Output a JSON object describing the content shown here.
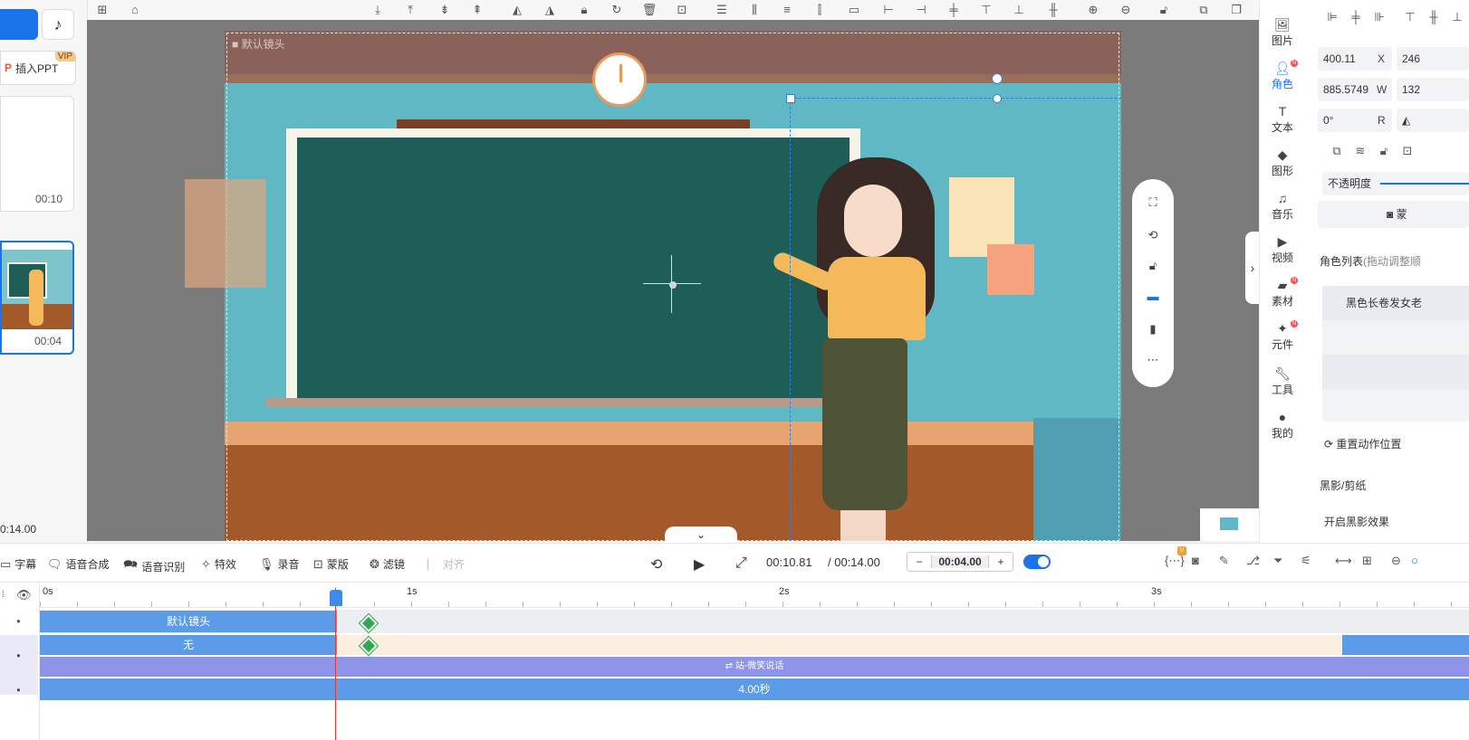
{
  "left_panel": {
    "insert_ppt_label": "插入PPT",
    "vip_badge": "VIP",
    "scenes": [
      {
        "duration": "00:10"
      },
      {
        "duration": "00:04"
      }
    ],
    "total_duration": "0:14.00"
  },
  "canvas": {
    "camera_label": "默认镜头"
  },
  "right_sidebar": {
    "items": [
      {
        "label": "图片",
        "icon": "image-icon"
      },
      {
        "label": "角色",
        "icon": "character-icon",
        "active": true,
        "dot": "N"
      },
      {
        "label": "文本",
        "icon": "text-icon"
      },
      {
        "label": "图形",
        "icon": "shape-icon"
      },
      {
        "label": "音乐",
        "icon": "music-icon"
      },
      {
        "label": "视频",
        "icon": "video-icon"
      },
      {
        "label": "素材",
        "icon": "material-icon",
        "dot": "N"
      },
      {
        "label": "元件",
        "icon": "component-icon",
        "dot": "N"
      },
      {
        "label": "工具",
        "icon": "tool-icon"
      },
      {
        "label": "我的",
        "icon": "user-icon"
      }
    ]
  },
  "properties": {
    "x_value": "400.11",
    "x_unit": "X",
    "y_value": "246",
    "w_value": "885.5749",
    "w_unit": "W",
    "h_value": "132",
    "r_value": "0°",
    "r_unit": "R",
    "opacity_label": "不透明度",
    "mask_label": "蒙",
    "role_list_label": "角色列表",
    "role_list_hint": "(拖动调整顺",
    "role_name": "黑色长卷发女老",
    "reset_action_label": "重置动作位置",
    "silhouette_label": "黑影/剪纸",
    "silhouette_toggle_label": "开启黑影效果"
  },
  "bottom_toolbar": {
    "items": [
      {
        "label": "字幕",
        "icon": "subtitle-icon"
      },
      {
        "label": "语音合成",
        "icon": "tts-icon"
      },
      {
        "label": "语音识别",
        "icon": "asr-icon"
      },
      {
        "label": "特效",
        "icon": "effect-icon"
      },
      {
        "label": "录音",
        "icon": "mic-icon"
      },
      {
        "label": "蒙版",
        "icon": "mask-icon"
      },
      {
        "label": "滤镜",
        "icon": "filter-icon"
      },
      {
        "label": "对齐",
        "icon": "align-icon",
        "disabled": true
      }
    ],
    "current_time": "00:10.81",
    "total_time": "/ 00:14.00",
    "step_minus": "−",
    "step_value": "00:04.00",
    "step_plus": "+",
    "v_badge": "V"
  },
  "timeline": {
    "ruler_labels": [
      "0s",
      "1s",
      "2s",
      "3s"
    ],
    "tracks": [
      {
        "label": "默认镜头",
        "color": "#5b9be8"
      },
      {
        "label": "无",
        "color": "#5b9be8"
      },
      {
        "label": "⇄ 站-微笑说话",
        "color": "#8e95e8"
      },
      {
        "label": "4.00秒",
        "color": "#5b9be8"
      }
    ]
  }
}
